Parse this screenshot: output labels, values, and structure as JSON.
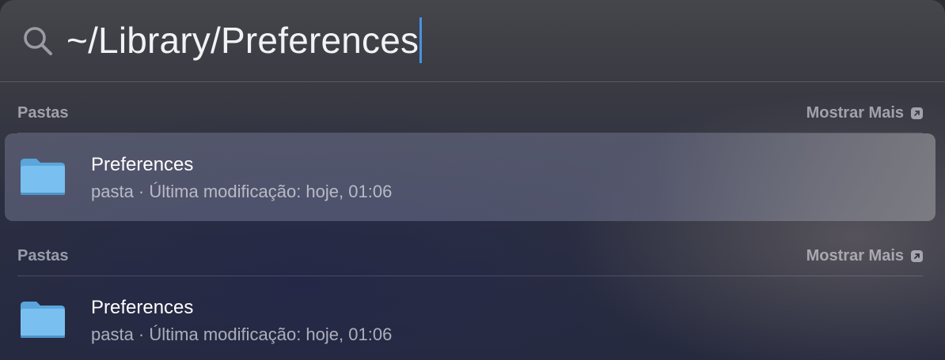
{
  "search": {
    "query": "~/Library/Preferences",
    "icon": "search-icon"
  },
  "sections": [
    {
      "header": "Pastas",
      "more_label": "Mostrar Mais",
      "more_icon": "arrow-up-right-square-icon",
      "result": {
        "title": "Preferences",
        "subtitle": "pasta · Última modificação: hoje, 01:06",
        "icon": "folder-icon",
        "selected": true
      }
    },
    {
      "header": "Pastas",
      "more_label": "Mostrar Mais",
      "more_icon": "arrow-up-right-square-icon",
      "result": {
        "title": "Preferences",
        "subtitle": "pasta · Última modificação: hoje, 01:06",
        "icon": "folder-icon",
        "selected": false
      }
    }
  ],
  "colors": {
    "caret": "#4a90e2",
    "folder": "#6cb8ee"
  }
}
